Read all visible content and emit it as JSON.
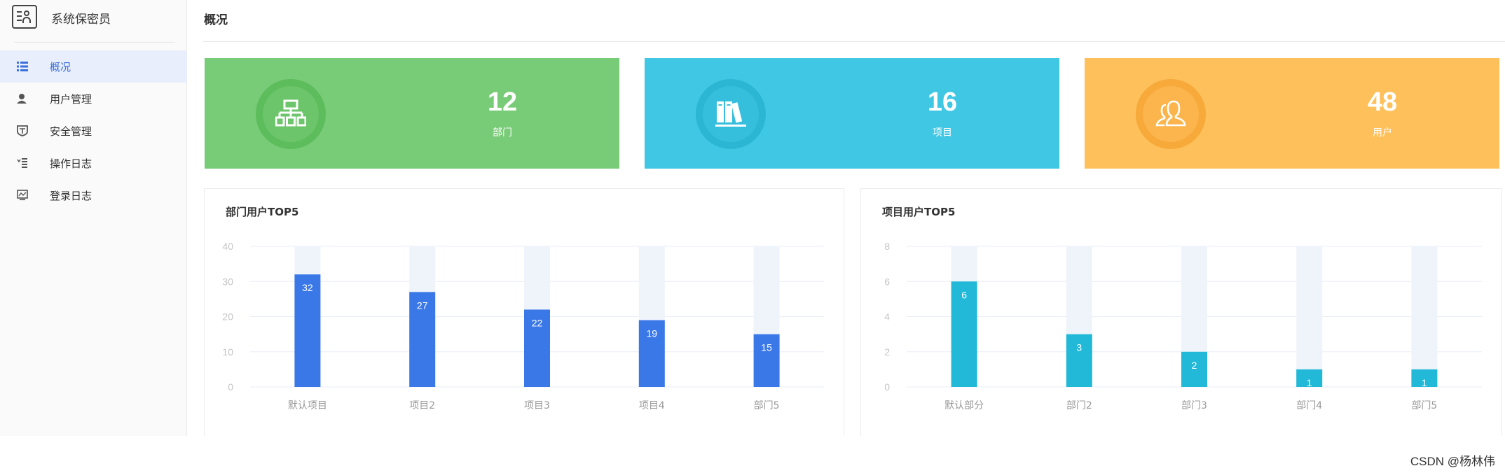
{
  "app": {
    "title": "系统保密员"
  },
  "sidebar": {
    "items": [
      {
        "label": "概况",
        "icon": "list-icon",
        "active": true
      },
      {
        "label": "用户管理",
        "icon": "user-icon",
        "active": false
      },
      {
        "label": "安全管理",
        "icon": "shield-icon",
        "active": false
      },
      {
        "label": "操作日志",
        "icon": "log-icon",
        "active": false
      },
      {
        "label": "登录日志",
        "icon": "monitor-icon",
        "active": false
      }
    ]
  },
  "page": {
    "title": "概况"
  },
  "stats": [
    {
      "value": "12",
      "label": "部门",
      "icon": "org-chart-icon",
      "color": "#78cb77",
      "ring": "#5dbd5c",
      "inner": "#6cc56b"
    },
    {
      "value": "16",
      "label": "项目",
      "icon": "books-icon",
      "color": "#40c7e4",
      "ring": "#2bb6d4",
      "inner": "#36bfdd"
    },
    {
      "value": "48",
      "label": "用户",
      "icon": "users-icon",
      "color": "#fec05a",
      "ring": "#f7a93a",
      "inner": "#fbb54c"
    }
  ],
  "chart_data": [
    {
      "type": "bar",
      "title": "部门用户TOP5",
      "categories": [
        "默认项目",
        "项目2",
        "项目3",
        "项目4",
        "部门5"
      ],
      "values": [
        32,
        27,
        22,
        19,
        15
      ],
      "ylim": [
        0,
        40
      ],
      "yticks": [
        0,
        10,
        20,
        30,
        40
      ],
      "bar_color": "#3b78e7",
      "bg_bar_color": "#eff4fb",
      "data_labels": true,
      "grid": true
    },
    {
      "type": "bar",
      "title": "项目用户TOP5",
      "categories": [
        "默认部分",
        "部门2",
        "部门3",
        "部门4",
        "部门5"
      ],
      "values": [
        6,
        3,
        2,
        1,
        1
      ],
      "ylim": [
        0,
        8
      ],
      "yticks": [
        0,
        2,
        4,
        6,
        8
      ],
      "bar_color": "#22b8d8",
      "bg_bar_color": "#eff4fb",
      "data_labels": true,
      "grid": true
    }
  ],
  "footer": {
    "watermark": "CSDN @杨林伟"
  }
}
